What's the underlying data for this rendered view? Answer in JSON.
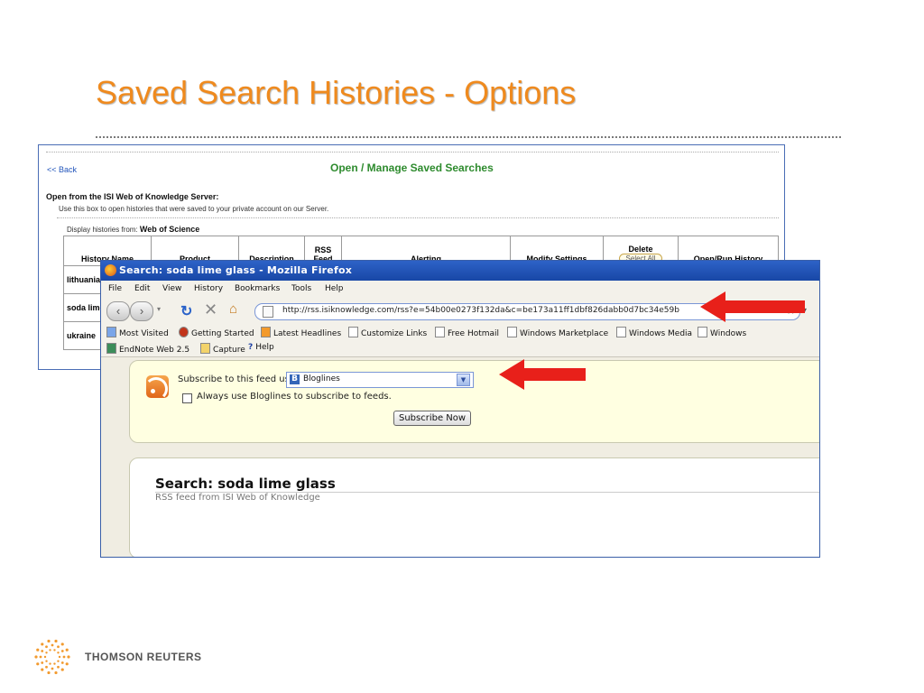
{
  "slide": {
    "title": "Saved Search Histories - Options",
    "footer_logo_text": "THOMSON REUTERS"
  },
  "isi": {
    "back_link": "<< Back",
    "heading": "Open / Manage Saved Searches",
    "open_from": "Open from the ISI Web of Knowledge Server:",
    "use_box_text": "Use this box to open histories that were saved to your private account on our Server.",
    "display_from_label": "Display histories from:",
    "display_from_value": "Web of Science",
    "columns": [
      "History Name",
      "Product",
      "Description",
      "RSS Feed",
      "Alerting",
      "Modify Settings",
      "Delete",
      "Open/Run History"
    ],
    "select_all": "Select All",
    "rows": [
      "lithuania",
      "soda lime glass",
      "ukraine"
    ]
  },
  "firefox": {
    "title": "Search: soda lime glass - Mozilla Firefox",
    "menu": [
      "File",
      "Edit",
      "View",
      "History",
      "Bookmarks",
      "Tools",
      "Help"
    ],
    "url": "http://rss.isiknowledge.com/rss?e=54b00e0273f132da&c=be173a11ff1dbf826dabb0d7bc34e59b",
    "bookmarks_row1": [
      "Most Visited",
      "Getting Started",
      "Latest Headlines",
      "Customize Links",
      "Free Hotmail",
      "Windows Marketplace",
      "Windows Media",
      "Windows"
    ],
    "bookmarks_row2": [
      "EndNote Web 2.5",
      "Capture",
      "Help"
    ],
    "subscribe_label": "Subscribe to this feed using",
    "reader_selected": "Bloglines",
    "always_use": "Always use Bloglines to subscribe to feeds.",
    "subscribe_button": "Subscribe Now",
    "feed_title": "Search: soda lime glass",
    "feed_subtitle": "RSS feed from ISI Web of Knowledge"
  },
  "colors": {
    "title_orange": "#ef8a1e",
    "isi_heading_green": "#2e8b2e",
    "firefox_titlebar_blue": "#1f52b6",
    "arrow_red": "#e8201a"
  }
}
